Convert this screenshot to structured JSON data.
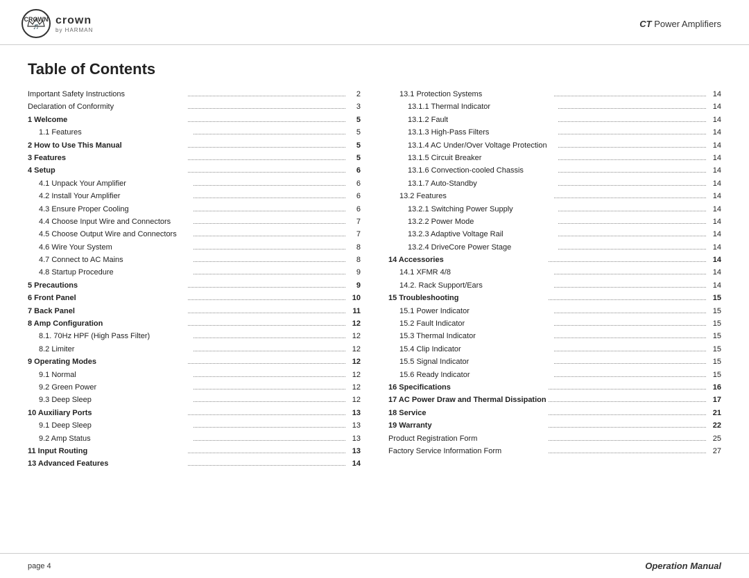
{
  "header": {
    "brand_name": "crown",
    "brand_sub": "by HARMAN",
    "title_ct": "CT",
    "title_rest": " Power Amplifiers"
  },
  "page_title": "Table of Contents",
  "footer": {
    "page_label": "page 4",
    "manual_label": "Operation Manual"
  },
  "toc_left": [
    {
      "label": "Important Safety Instructions",
      "dots": true,
      "page": "2",
      "bold": false,
      "indent": 0
    },
    {
      "label": "Declaration of Conformity",
      "dots": true,
      "page": "3",
      "bold": false,
      "indent": 0
    },
    {
      "label": "1 Welcome",
      "dots": true,
      "page": "5",
      "bold": true,
      "indent": 0
    },
    {
      "label": "1.1 Features",
      "dots": true,
      "page": "5",
      "bold": false,
      "indent": 1
    },
    {
      "label": "2 How to Use This Manual",
      "dots": true,
      "page": "5",
      "bold": true,
      "indent": 0
    },
    {
      "label": "3 Features",
      "dots": true,
      "page": "5",
      "bold": true,
      "indent": 0
    },
    {
      "label": "4 Setup",
      "dots": true,
      "page": "6",
      "bold": true,
      "indent": 0
    },
    {
      "label": "4.1 Unpack Your Amplifier",
      "dots": true,
      "page": "6",
      "bold": false,
      "indent": 1
    },
    {
      "label": "4.2 Install Your Amplifier",
      "dots": true,
      "page": "6",
      "bold": false,
      "indent": 1
    },
    {
      "label": "4.3 Ensure Proper Cooling",
      "dots": true,
      "page": "6",
      "bold": false,
      "indent": 1
    },
    {
      "label": "4.4 Choose Input Wire and Connectors",
      "dots": true,
      "page": "7",
      "bold": false,
      "indent": 1
    },
    {
      "label": "4.5 Choose Output Wire and Connectors",
      "dots": true,
      "page": "7",
      "bold": false,
      "indent": 1
    },
    {
      "label": "4.6 Wire Your System",
      "dots": true,
      "page": "8",
      "bold": false,
      "indent": 1
    },
    {
      "label": "4.7 Connect to AC Mains",
      "dots": true,
      "page": "8",
      "bold": false,
      "indent": 1
    },
    {
      "label": "4.8 Startup Procedure",
      "dots": true,
      "page": "9",
      "bold": false,
      "indent": 1
    },
    {
      "label": "5 Precautions",
      "dots": true,
      "page": "9",
      "bold": true,
      "indent": 0
    },
    {
      "label": "6 Front Panel",
      "dots": true,
      "page": "10",
      "bold": true,
      "indent": 0
    },
    {
      "label": "7 Back Panel",
      "dots": true,
      "page": "11",
      "bold": true,
      "indent": 0
    },
    {
      "label": "8 Amp Configuration",
      "dots": true,
      "page": "12",
      "bold": true,
      "indent": 0
    },
    {
      "label": "8.1. 70Hz HPF (High Pass Filter)",
      "dots": true,
      "page": "12",
      "bold": false,
      "indent": 1
    },
    {
      "label": "8.2 Limiter",
      "dots": true,
      "page": "12",
      "bold": false,
      "indent": 1
    },
    {
      "label": "9 Operating Modes",
      "dots": true,
      "page": "12",
      "bold": true,
      "indent": 0
    },
    {
      "label": "9.1 Normal",
      "dots": true,
      "page": "12",
      "bold": false,
      "indent": 1
    },
    {
      "label": "9.2 Green Power",
      "dots": true,
      "page": "12",
      "bold": false,
      "indent": 1
    },
    {
      "label": "9.3 Deep Sleep",
      "dots": true,
      "page": "12",
      "bold": false,
      "indent": 1
    },
    {
      "label": "10 Auxiliary Ports",
      "dots": true,
      "page": "13",
      "bold": true,
      "indent": 0
    },
    {
      "label": "9.1 Deep Sleep",
      "dots": true,
      "page": "13",
      "bold": false,
      "indent": 1
    },
    {
      "label": "9.2 Amp Status",
      "dots": true,
      "page": "13",
      "bold": false,
      "indent": 1
    },
    {
      "label": "11 Input Routing",
      "dots": true,
      "page": "13",
      "bold": true,
      "indent": 0
    },
    {
      "label": "13 Advanced Features",
      "dots": true,
      "page": "14",
      "bold": true,
      "indent": 0
    }
  ],
  "toc_right": [
    {
      "label": "13.1 Protection Systems",
      "dots": true,
      "page": "14",
      "bold": false,
      "indent": 1
    },
    {
      "label": "13.1.1 Thermal Indicator",
      "dots": true,
      "page": "14",
      "bold": false,
      "indent": 2
    },
    {
      "label": "13.1.2 Fault",
      "dots": true,
      "page": "14",
      "bold": false,
      "indent": 2
    },
    {
      "label": "13.1.3 High-Pass Filters",
      "dots": true,
      "page": "14",
      "bold": false,
      "indent": 2
    },
    {
      "label": "13.1.4 AC Under/Over Voltage Protection",
      "dots": true,
      "page": "14",
      "bold": false,
      "indent": 2
    },
    {
      "label": "13.1.5 Circuit Breaker",
      "dots": true,
      "page": "14",
      "bold": false,
      "indent": 2
    },
    {
      "label": "13.1.6 Convection-cooled Chassis",
      "dots": true,
      "page": "14",
      "bold": false,
      "indent": 2
    },
    {
      "label": "13.1.7 Auto-Standby",
      "dots": true,
      "page": "14",
      "bold": false,
      "indent": 2
    },
    {
      "label": "13.2 Features",
      "dots": true,
      "page": "14",
      "bold": false,
      "indent": 1
    },
    {
      "label": "13.2.1 Switching Power Supply",
      "dots": true,
      "page": "14",
      "bold": false,
      "indent": 2
    },
    {
      "label": "13.2.2 Power Mode",
      "dots": true,
      "page": "14",
      "bold": false,
      "indent": 2
    },
    {
      "label": "13.2.3 Adaptive Voltage Rail",
      "dots": true,
      "page": "14",
      "bold": false,
      "indent": 2
    },
    {
      "label": "13.2.4 DriveCore Power Stage",
      "dots": true,
      "page": "14",
      "bold": false,
      "indent": 2
    },
    {
      "label": "14 Accessories",
      "dots": true,
      "page": "14",
      "bold": true,
      "indent": 0
    },
    {
      "label": "14.1 XFMR 4/8",
      "dots": true,
      "page": "14",
      "bold": false,
      "indent": 1
    },
    {
      "label": "14.2. Rack Support/Ears",
      "dots": true,
      "page": "14",
      "bold": false,
      "indent": 1
    },
    {
      "label": "15 Troubleshooting",
      "dots": true,
      "page": "15",
      "bold": true,
      "indent": 0
    },
    {
      "label": "15.1 Power Indicator",
      "dots": true,
      "page": "15",
      "bold": false,
      "indent": 1
    },
    {
      "label": "15.2 Fault Indicator",
      "dots": true,
      "page": "15",
      "bold": false,
      "indent": 1
    },
    {
      "label": "15.3 Thermal Indicator",
      "dots": true,
      "page": "15",
      "bold": false,
      "indent": 1
    },
    {
      "label": "15.4 Clip Indicator",
      "dots": true,
      "page": "15",
      "bold": false,
      "indent": 1
    },
    {
      "label": "15.5 Signal Indicator",
      "dots": true,
      "page": "15",
      "bold": false,
      "indent": 1
    },
    {
      "label": "15.6 Ready Indicator",
      "dots": true,
      "page": "15",
      "bold": false,
      "indent": 1
    },
    {
      "label": "16 Specifications",
      "dots": true,
      "page": "16",
      "bold": true,
      "indent": 0
    },
    {
      "label": "17 AC Power Draw and Thermal Dissipation",
      "dots": true,
      "page": "17",
      "bold": true,
      "indent": 0
    },
    {
      "label": "18 Service",
      "dots": true,
      "page": "21",
      "bold": true,
      "indent": 0
    },
    {
      "label": "19 Warranty",
      "dots": true,
      "page": "22",
      "bold": true,
      "indent": 0
    },
    {
      "label": "Product Registration Form",
      "dots": true,
      "page": "25",
      "bold": false,
      "indent": 0
    },
    {
      "label": "Factory Service Information Form",
      "dots": true,
      "page": "27",
      "bold": false,
      "indent": 0
    }
  ]
}
